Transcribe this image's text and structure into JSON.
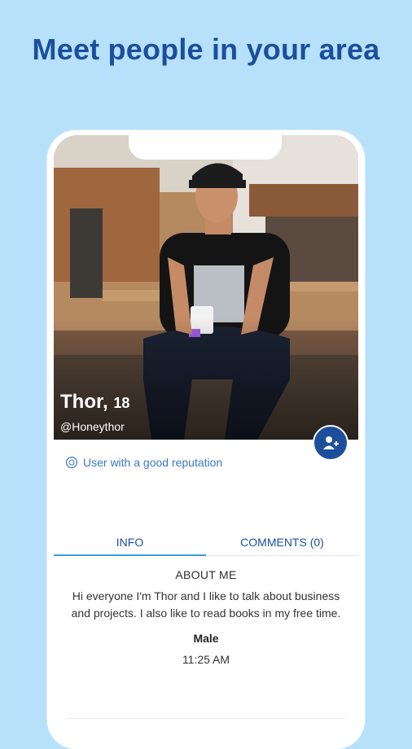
{
  "headline": "Meet people in your area",
  "profile": {
    "name": "Thor,",
    "age": "18",
    "username": "@Honeythor",
    "reputation": "User with a good reputation",
    "add_icon": "add-user-icon"
  },
  "tabs": [
    {
      "label": "INFO",
      "active": true
    },
    {
      "label": "COMMENTS (0)",
      "active": false
    }
  ],
  "about": {
    "title": "ABOUT ME",
    "text": "Hi everyone I'm Thor and I like to talk about business and projects. I also like to read books in my free time.",
    "gender": "Male",
    "time": "11:25 AM"
  },
  "colors": {
    "background": "#b7e1fb",
    "headline": "#1b4f9c",
    "accent": "#3a9ad9",
    "button": "#1b4f9c"
  }
}
